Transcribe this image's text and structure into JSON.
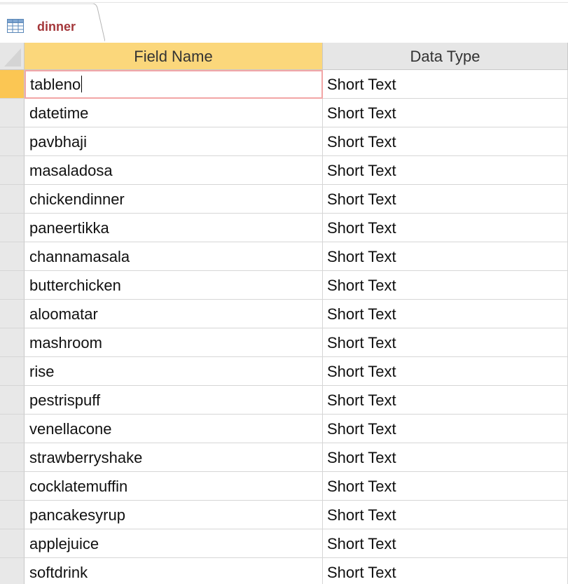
{
  "tab": {
    "label": "dinner",
    "icon": "table-icon"
  },
  "colors": {
    "tab_label": "#a4373a",
    "header_active": "#fbd77b",
    "row_selector_current": "#fbc653",
    "edit_border": "#f2a6a6"
  },
  "grid": {
    "columns": {
      "field_name": "Field Name",
      "data_type": "Data Type"
    },
    "rows": [
      {
        "field_name": "tableno",
        "data_type": "Short Text"
      },
      {
        "field_name": "datetime",
        "data_type": "Short Text"
      },
      {
        "field_name": "pavbhaji",
        "data_type": "Short Text"
      },
      {
        "field_name": "masaladosa",
        "data_type": "Short Text"
      },
      {
        "field_name": "chickendinner",
        "data_type": "Short Text"
      },
      {
        "field_name": "paneertikka",
        "data_type": "Short Text"
      },
      {
        "field_name": "channamasala",
        "data_type": "Short Text"
      },
      {
        "field_name": "butterchicken",
        "data_type": "Short Text"
      },
      {
        "field_name": "aloomatar",
        "data_type": "Short Text"
      },
      {
        "field_name": "mashroom",
        "data_type": "Short Text"
      },
      {
        "field_name": "rise",
        "data_type": "Short Text"
      },
      {
        "field_name": "pestrispuff",
        "data_type": "Short Text"
      },
      {
        "field_name": "venellacone",
        "data_type": "Short Text"
      },
      {
        "field_name": "strawberryshake",
        "data_type": "Short Text"
      },
      {
        "field_name": "cocklatemuffin",
        "data_type": "Short Text"
      },
      {
        "field_name": "pancakesyrup",
        "data_type": "Short Text"
      },
      {
        "field_name": "applejuice",
        "data_type": "Short Text"
      },
      {
        "field_name": "softdrink",
        "data_type": "Short Text"
      }
    ]
  }
}
